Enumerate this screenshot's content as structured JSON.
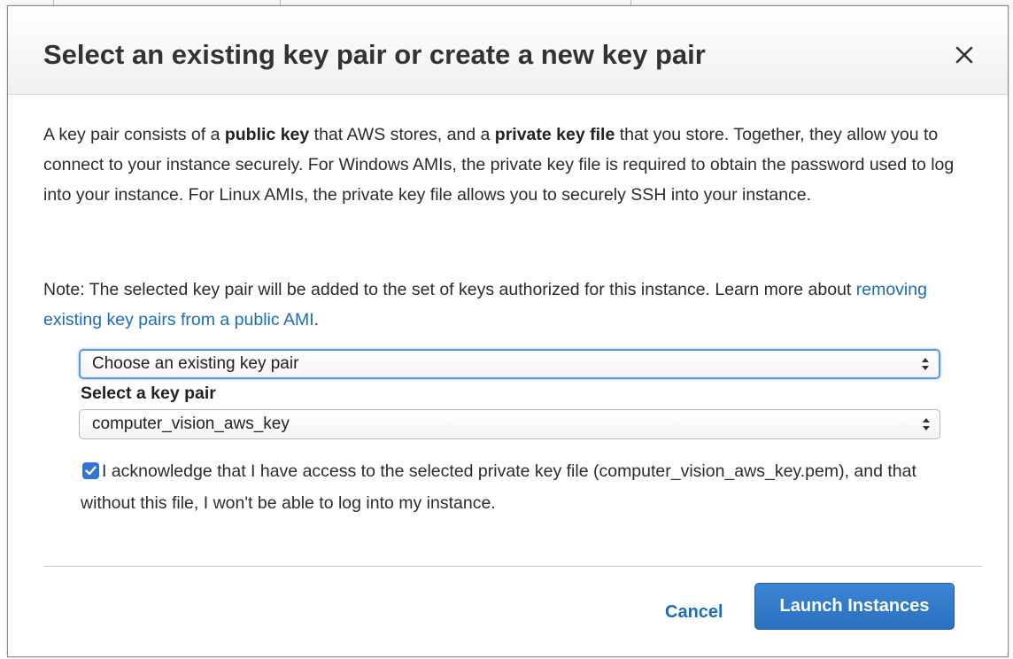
{
  "dialog": {
    "title": "Select an existing key pair or create a new key pair",
    "description_parts": [
      {
        "text": "A key pair consists of a ",
        "bold": false
      },
      {
        "text": "public key",
        "bold": true
      },
      {
        "text": " that AWS stores, and a ",
        "bold": false
      },
      {
        "text": "private key file",
        "bold": true
      },
      {
        "text": " that you store. Together, they allow you to connect to your instance securely. For Windows AMIs, the private key file is required to obtain the password used to log into your instance. For Linux AMIs, the private key file allows you to securely SSH into your instance.",
        "bold": false
      }
    ],
    "note_prefix": "Note: The selected key pair will be added to the set of keys authorized for this instance. Learn more about ",
    "note_link": "removing existing key pairs from a public AMI",
    "note_suffix": ".",
    "key_pair_mode_select": {
      "selected": "Choose an existing key pair"
    },
    "key_pair_label": "Select a key pair",
    "key_pair_select": {
      "selected": "computer_vision_aws_key"
    },
    "acknowledge": {
      "checked": true,
      "text": "I acknowledge that I have access to the selected private key file (computer_vision_aws_key.pem), and that without this file, I won't be able to log into my instance."
    },
    "cancel_label": "Cancel",
    "launch_label": "Launch Instances"
  },
  "colors": {
    "primary_button": "#2f78c8",
    "link": "#1a6db5",
    "checkbox": "#2f76d2",
    "focus_ring": "#5b9be0"
  }
}
